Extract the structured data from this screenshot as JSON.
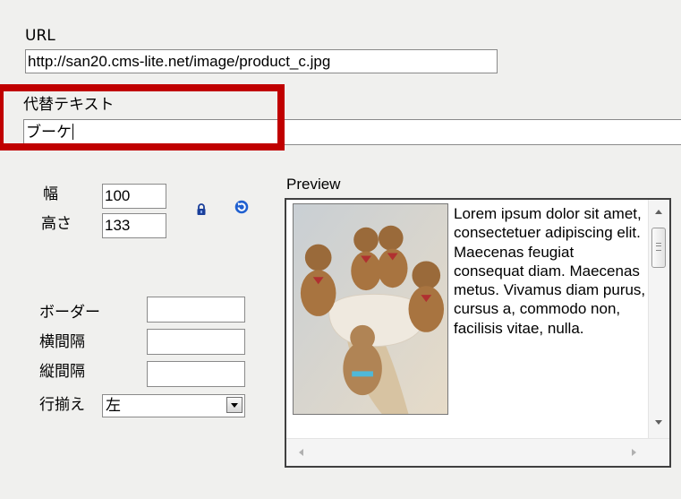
{
  "url": {
    "label": "URL",
    "value": "http://san20.cms-lite.net/image/product_c.jpg"
  },
  "alt_text": {
    "label": "代替テキスト",
    "value": "ブーケ"
  },
  "dimensions": {
    "width_label": "幅",
    "width_value": "100",
    "height_label": "高さ",
    "height_value": "133",
    "lock_icon": "lock-icon",
    "reset_icon": "refresh-icon"
  },
  "spacing": {
    "border_label": "ボーダー",
    "border_value": "",
    "hspace_label": "横間隔",
    "hspace_value": "",
    "vspace_label": "縦間隔",
    "vspace_value": "",
    "align_label": "行揃え",
    "align_value": "左"
  },
  "preview": {
    "label": "Preview",
    "image_icon": "teddy-bear-bouquet-image",
    "text": "Lorem ipsum dolor sit amet, consectetuer adipiscing elit. Maecenas feugiat consequat diam. Maecenas metus. Vivamus diam purus, cursus a, commodo non, facilisis vitae, nulla."
  },
  "colors": {
    "highlight": "#c00000",
    "lock": "#1a3f9a",
    "refresh": "#2060d0"
  }
}
